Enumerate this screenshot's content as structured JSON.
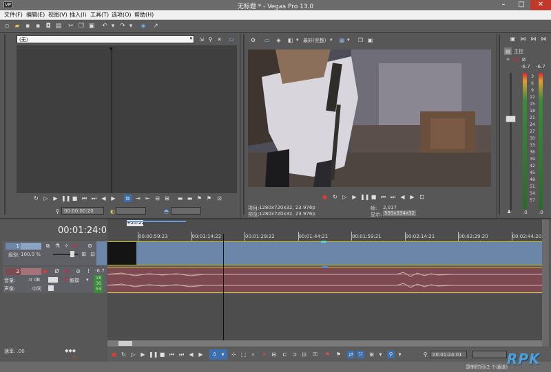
{
  "window": {
    "title": "无标题 * - Vegas Pro 13.0",
    "app_icon": "VP"
  },
  "menu": [
    "文件(F)",
    "编辑(E)",
    "视图(V)",
    "插入(I)",
    "工具(T)",
    "选项(O)",
    "帮助(H)"
  ],
  "trimmer": {
    "source_select": "(无)",
    "timecode": "00:00:00:20"
  },
  "preview": {
    "quality": "最好(完整)",
    "project_label": "项目:",
    "project_value": "1280x720x32, 23.976p",
    "preview_label": "预览:",
    "preview_value": "1280x720x32, 23.976p",
    "frame_label": "帧:",
    "frame_value": "2,017",
    "display_label": "显示:",
    "display_value": "593x334x32"
  },
  "master": {
    "title": "主控",
    "left_peak": "-6.7",
    "right_peak": "-6.7",
    "scale": [
      "3",
      "6",
      "9",
      "12",
      "15",
      "18",
      "21",
      "24",
      "27",
      "30",
      "33",
      "36",
      "39",
      "42",
      "45",
      "48",
      "51",
      "54",
      "57"
    ],
    "bottom_left": ".0",
    "bottom_right": ".0"
  },
  "timeline": {
    "current_time": "00:01:24:01",
    "region_marker": "+25:22",
    "ruler": [
      "00:00:59:23",
      "00:01:14:22",
      "00:01:29:22",
      "00:01:44:21",
      "00:01:59:21",
      "00:02:14:21",
      "00:02:29:20",
      "00:02:44:20"
    ],
    "playhead_position_fraction": 0.266,
    "video_track": {
      "number": "1",
      "level_label": "级别:",
      "level_value": "100.0 %"
    },
    "audio_track": {
      "number": "2",
      "volume_label": "音量:",
      "volume_value": ".0 dB",
      "pan_label": "声像:",
      "pan_value": "中间",
      "mode": "触摸",
      "peak": "-6.7",
      "meter_labels": [
        "18",
        "36",
        "54"
      ]
    },
    "rate_label": "速率: .00",
    "bottom_timecode": "00:01:24:01",
    "status": "录制时间(2 个通道)"
  },
  "watermark": "RPK",
  "colors": {
    "video_track": "#6b86a8",
    "audio_track": "#7e4a52",
    "track_border": "#c9c030",
    "timeline_bg": "#505050",
    "playhead": "#111111"
  }
}
